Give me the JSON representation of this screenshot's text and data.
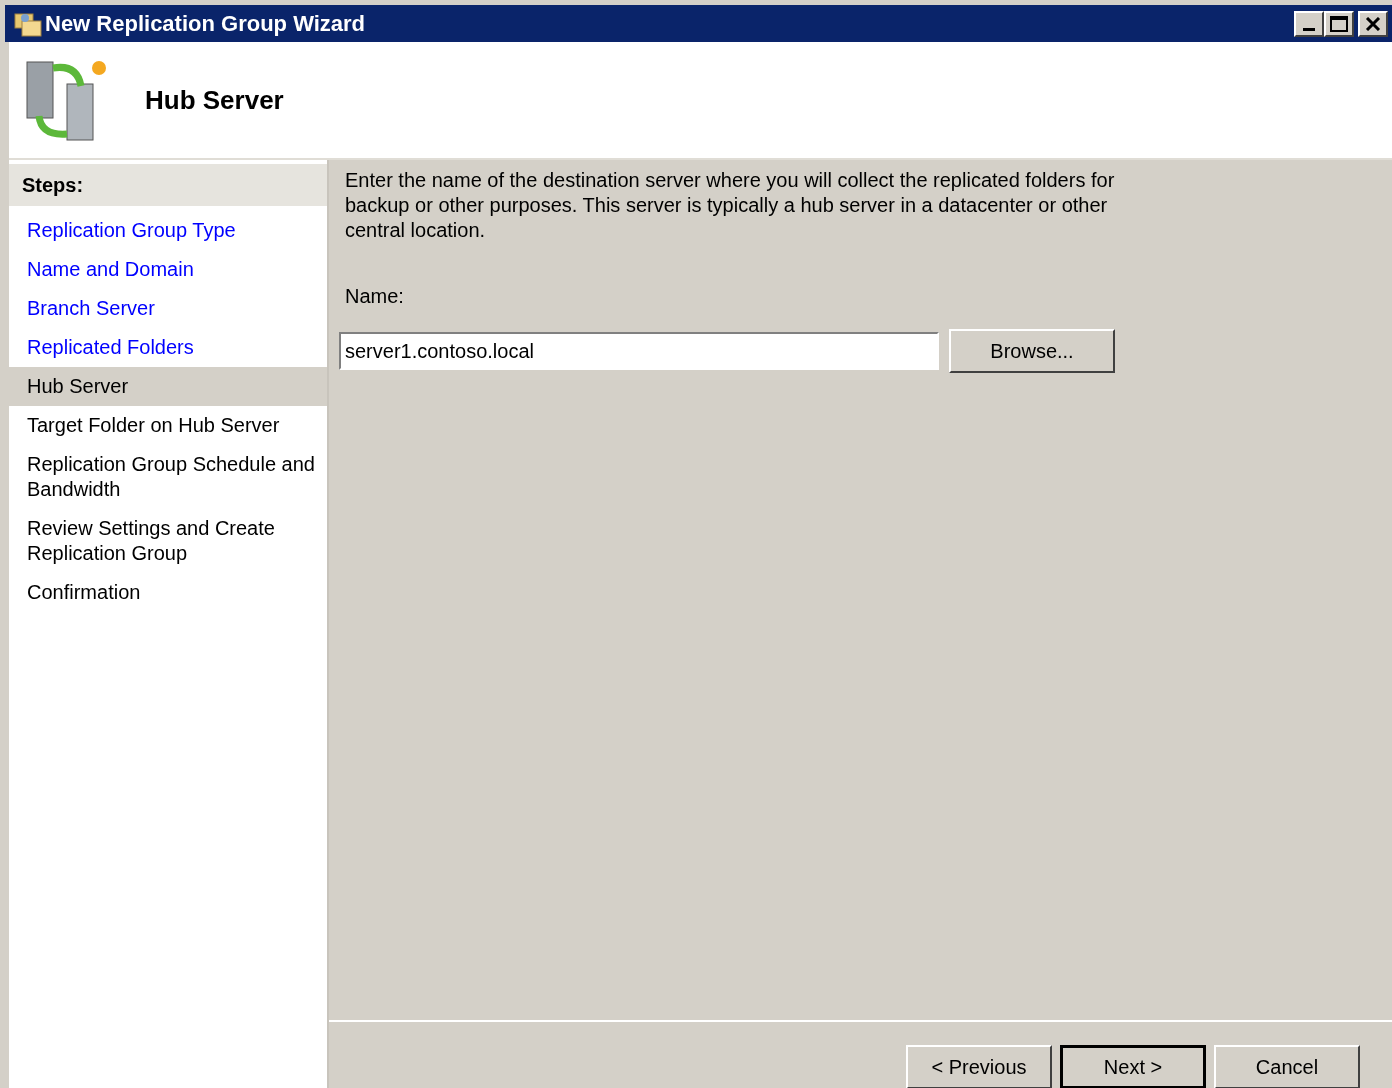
{
  "window": {
    "title": "New Replication Group Wizard"
  },
  "header": {
    "title": "Hub Server"
  },
  "steps": {
    "heading": "Steps:",
    "items": [
      {
        "label": "Replication Group Type",
        "completed": true,
        "selected": false
      },
      {
        "label": "Name and Domain",
        "completed": true,
        "selected": false
      },
      {
        "label": "Branch Server",
        "completed": true,
        "selected": false
      },
      {
        "label": "Replicated Folders",
        "completed": true,
        "selected": false
      },
      {
        "label": "Hub Server",
        "completed": false,
        "selected": true
      },
      {
        "label": "Target Folder on Hub Server",
        "completed": false,
        "selected": false
      },
      {
        "label": "Replication Group Schedule and Bandwidth",
        "completed": false,
        "selected": false
      },
      {
        "label": "Review Settings and Create Replication Group",
        "completed": false,
        "selected": false
      },
      {
        "label": "Confirmation",
        "completed": false,
        "selected": false
      }
    ]
  },
  "content": {
    "description": "Enter the name of the destination server where you will collect the replicated folders for backup or other purposes. This server is typically a hub server in a datacenter or other central location.",
    "name_label": "Name:",
    "name_value": "server1.contoso.local",
    "browse_button": "Browse..."
  },
  "buttons": [
    {
      "label": "< Previous",
      "default": false
    },
    {
      "label": "Next >",
      "default": true
    },
    {
      "label": "Cancel",
      "default": false
    }
  ]
}
